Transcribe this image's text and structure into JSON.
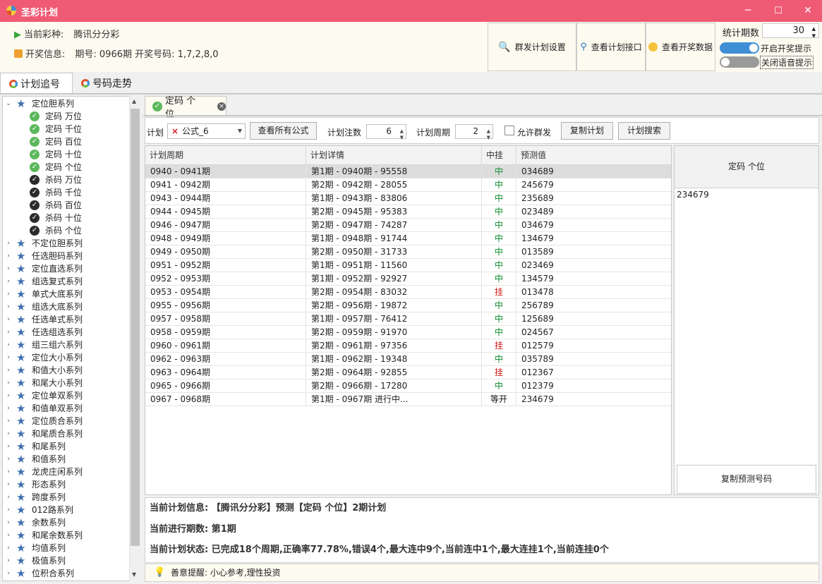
{
  "window": {
    "title": "圣彩计划",
    "minimize_icon": "─",
    "maximize_icon": "☐",
    "close_icon": "✕"
  },
  "info": {
    "lottery_label": "当前彩种:",
    "lottery_value": "腾讯分分彩",
    "draw_label": "开奖信息:",
    "draw_value": "期号: 0966期  开奖号码: 1,7,2,8,0"
  },
  "actions": {
    "group_plan_settings": "群发计划设置",
    "view_plan_api": "查看计划接口",
    "view_draw_data": "查看开奖数据"
  },
  "stats": {
    "periods_label": "统计期数",
    "periods_value": "30",
    "toggle_draw_notice": "开启开奖提示",
    "toggle_voice_notice": "关闭语音提示",
    "accent_color": "#3f8fd6"
  },
  "main_tabs": [
    "计划追号",
    "号码走势"
  ],
  "tree": [
    {
      "label": "定位胆系列",
      "expanded": true,
      "children": [
        {
          "label": "定码 万位",
          "kind": "green"
        },
        {
          "label": "定码 千位",
          "kind": "green"
        },
        {
          "label": "定码 百位",
          "kind": "green"
        },
        {
          "label": "定码 十位",
          "kind": "green"
        },
        {
          "label": "定码 个位",
          "kind": "green"
        },
        {
          "label": "杀码 万位",
          "kind": "dark"
        },
        {
          "label": "杀码 千位",
          "kind": "dark"
        },
        {
          "label": "杀码 百位",
          "kind": "dark"
        },
        {
          "label": "杀码 十位",
          "kind": "dark"
        },
        {
          "label": "杀码 个位",
          "kind": "dark"
        }
      ]
    },
    {
      "label": "不定位胆系列"
    },
    {
      "label": "任选胆码系列"
    },
    {
      "label": "定位直选系列"
    },
    {
      "label": "组选复式系列"
    },
    {
      "label": "单式大底系列"
    },
    {
      "label": "组选大底系列"
    },
    {
      "label": "任选单式系列"
    },
    {
      "label": "任选组选系列"
    },
    {
      "label": "组三组六系列"
    },
    {
      "label": "定位大小系列"
    },
    {
      "label": "和值大小系列"
    },
    {
      "label": "和尾大小系列"
    },
    {
      "label": "定位单双系列"
    },
    {
      "label": "和值单双系列"
    },
    {
      "label": "定位质合系列"
    },
    {
      "label": "和尾质合系列"
    },
    {
      "label": "和尾系列"
    },
    {
      "label": "和值系列"
    },
    {
      "label": "龙虎庄闲系列"
    },
    {
      "label": "形态系列"
    },
    {
      "label": "跨度系列"
    },
    {
      "label": "012路系列"
    },
    {
      "label": "余数系列"
    },
    {
      "label": "和尾余数系列"
    },
    {
      "label": "均值系列"
    },
    {
      "label": "极值系列"
    },
    {
      "label": "位积合系列"
    }
  ],
  "doc_tab": {
    "label": "定码 个位"
  },
  "toolbar": {
    "plan_label": "计划",
    "plan_value": "公式_6",
    "view_all_formulas": "查看所有公式",
    "bet_count_label": "计划注数",
    "bet_count_value": "6",
    "cycle_label": "计划周期",
    "cycle_value": "2",
    "allow_group_send": "允许群发",
    "copy_plan": "复制计划",
    "plan_search": "计划搜索"
  },
  "grid": {
    "columns": [
      "计划周期",
      "计划详情",
      "中挂",
      "预测值"
    ],
    "rows": [
      [
        "0940 - 0941期",
        "第1期 - 0940期 - 95558",
        "中",
        "034689"
      ],
      [
        "0941 - 0942期",
        "第2期 - 0942期 - 28055",
        "中",
        "245679"
      ],
      [
        "0943 - 0944期",
        "第1期 - 0943期 - 83806",
        "中",
        "235689"
      ],
      [
        "0944 - 0945期",
        "第2期 - 0945期 - 95383",
        "中",
        "023489"
      ],
      [
        "0946 - 0947期",
        "第2期 - 0947期 - 74287",
        "中",
        "034679"
      ],
      [
        "0948 - 0949期",
        "第1期 - 0948期 - 91744",
        "中",
        "134679"
      ],
      [
        "0949 - 0950期",
        "第2期 - 0950期 - 31733",
        "中",
        "013589"
      ],
      [
        "0951 - 0952期",
        "第1期 - 0951期 - 11560",
        "中",
        "023469"
      ],
      [
        "0952 - 0953期",
        "第1期 - 0952期 - 92927",
        "中",
        "134579"
      ],
      [
        "0953 - 0954期",
        "第2期 - 0954期 - 83032",
        "挂",
        "013478"
      ],
      [
        "0955 - 0956期",
        "第2期 - 0956期 - 19872",
        "中",
        "256789"
      ],
      [
        "0957 - 0958期",
        "第1期 - 0957期 - 76412",
        "中",
        "125689"
      ],
      [
        "0958 - 0959期",
        "第2期 - 0959期 - 91970",
        "中",
        "024567"
      ],
      [
        "0960 - 0961期",
        "第2期 - 0961期 - 97356",
        "挂",
        "012579"
      ],
      [
        "0962 - 0963期",
        "第1期 - 0962期 - 19348",
        "中",
        "035789"
      ],
      [
        "0963 - 0964期",
        "第2期 - 0964期 - 92855",
        "挂",
        "012367"
      ],
      [
        "0965 - 0966期",
        "第2期 - 0966期 - 17280",
        "中",
        "012379"
      ],
      [
        "0967 - 0968期",
        "第1期 - 0967期 进行中...",
        "等开",
        "234679"
      ]
    ]
  },
  "side_panel": {
    "title": "定码 个位",
    "prediction": "234679",
    "copy_button": "复制预测号码"
  },
  "status": {
    "line1": "当前计划信息:  【腾讯分分彩】预测【定码 个位】2期计划",
    "line2": "当前进行期数:  第1期",
    "line3": "当前计划状态:  已完成18个周期,正确率77.78%,错误4个,最大连中9个,当前连中1个,最大连挂1个,当前连挂0个"
  },
  "footer": {
    "tip": "善意提醒: 小心参考,理性投资"
  }
}
